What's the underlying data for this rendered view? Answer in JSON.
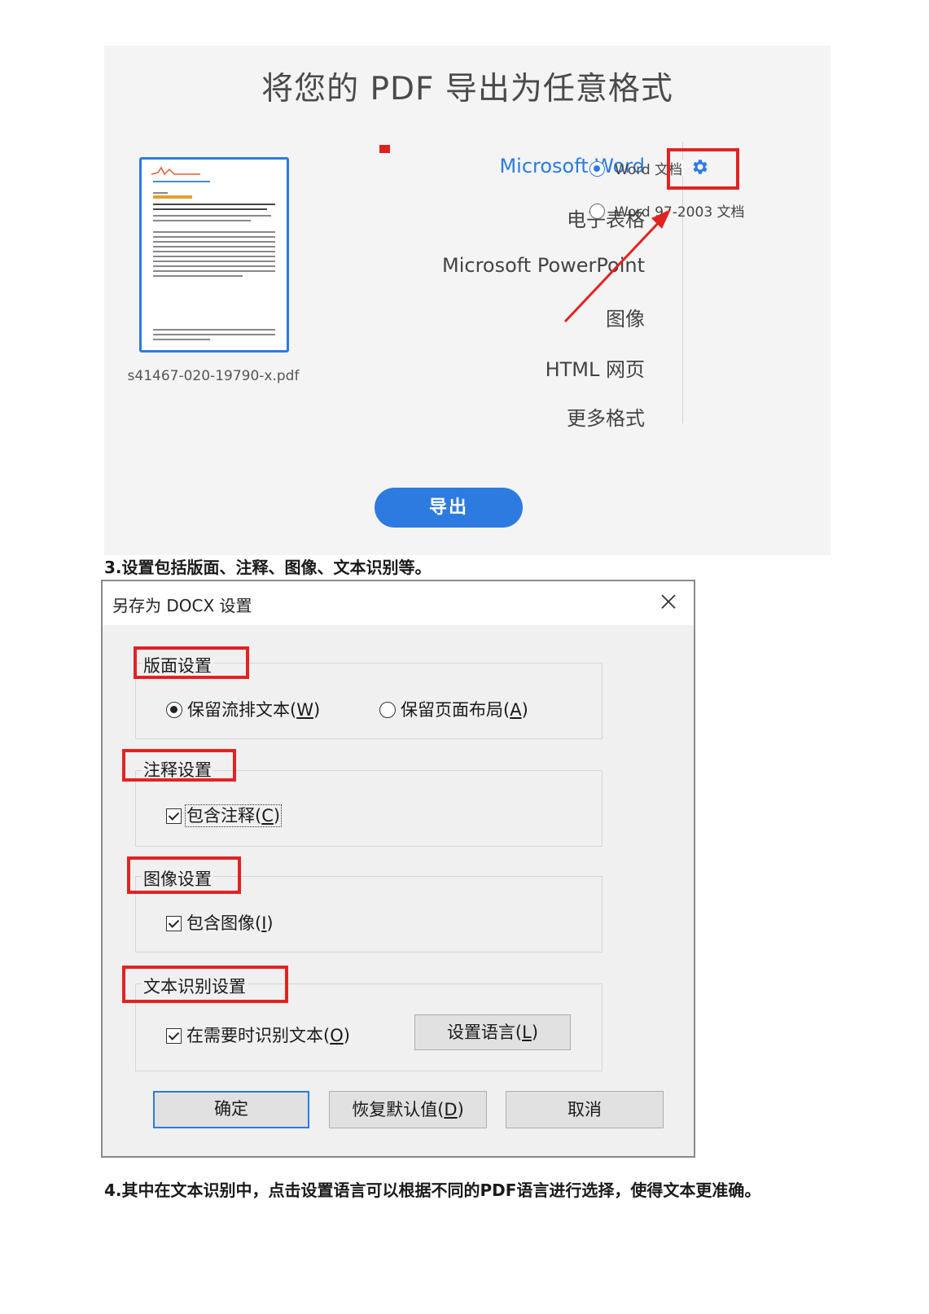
{
  "export": {
    "title": "将您的 PDF 导出为任意格式",
    "file_name": "s41467-020-19790-x.pdf",
    "formats": [
      "Microsoft Word",
      "电子表格",
      "Microsoft PowerPoint",
      "图像",
      "HTML 网页",
      "更多格式"
    ],
    "active_format_index": 0,
    "word_options": [
      {
        "label": "Word 文档",
        "checked": true
      },
      {
        "label": "Word 97-2003 文档",
        "checked": false
      }
    ],
    "settings_icon": "gear-icon",
    "export_button": "导出",
    "accent_color": "#2d7be0",
    "highlight_color": "#e32222"
  },
  "caption3": "3.设置包括版面、注释、图像、文本识别等。",
  "dialog": {
    "title": "另存为 DOCX 设置",
    "close_icon": "close-icon",
    "layout_group": {
      "label": "版面设置",
      "options": [
        {
          "text": "保留流排文本(",
          "key": "W",
          "end": ")",
          "checked": true
        },
        {
          "text": "保留页面布局(",
          "key": "A",
          "end": ")",
          "checked": false
        }
      ]
    },
    "comment_group": {
      "label": "注释设置",
      "checkbox": {
        "text": "包含注释(",
        "key": "C",
        "end": ")",
        "checked": true
      }
    },
    "image_group": {
      "label": "图像设置",
      "checkbox": {
        "text": "包含图像(",
        "key": "I",
        "end": ")",
        "checked": true
      }
    },
    "ocr_group": {
      "label": "文本识别设置",
      "checkbox": {
        "text": "在需要时识别文本(",
        "key": "O",
        "end": ")",
        "checked": true
      },
      "language_button": {
        "text": "设置语言(",
        "key": "L",
        "end": ")"
      }
    },
    "buttons": {
      "ok": "确定",
      "restore": {
        "text": "恢复默认值(",
        "key": "D",
        "end": ")"
      },
      "cancel": "取消"
    }
  },
  "caption4": "4.其中在文本识别中，点击设置语言可以根据不同的PDF语言进行选择，使得文本更准确。"
}
